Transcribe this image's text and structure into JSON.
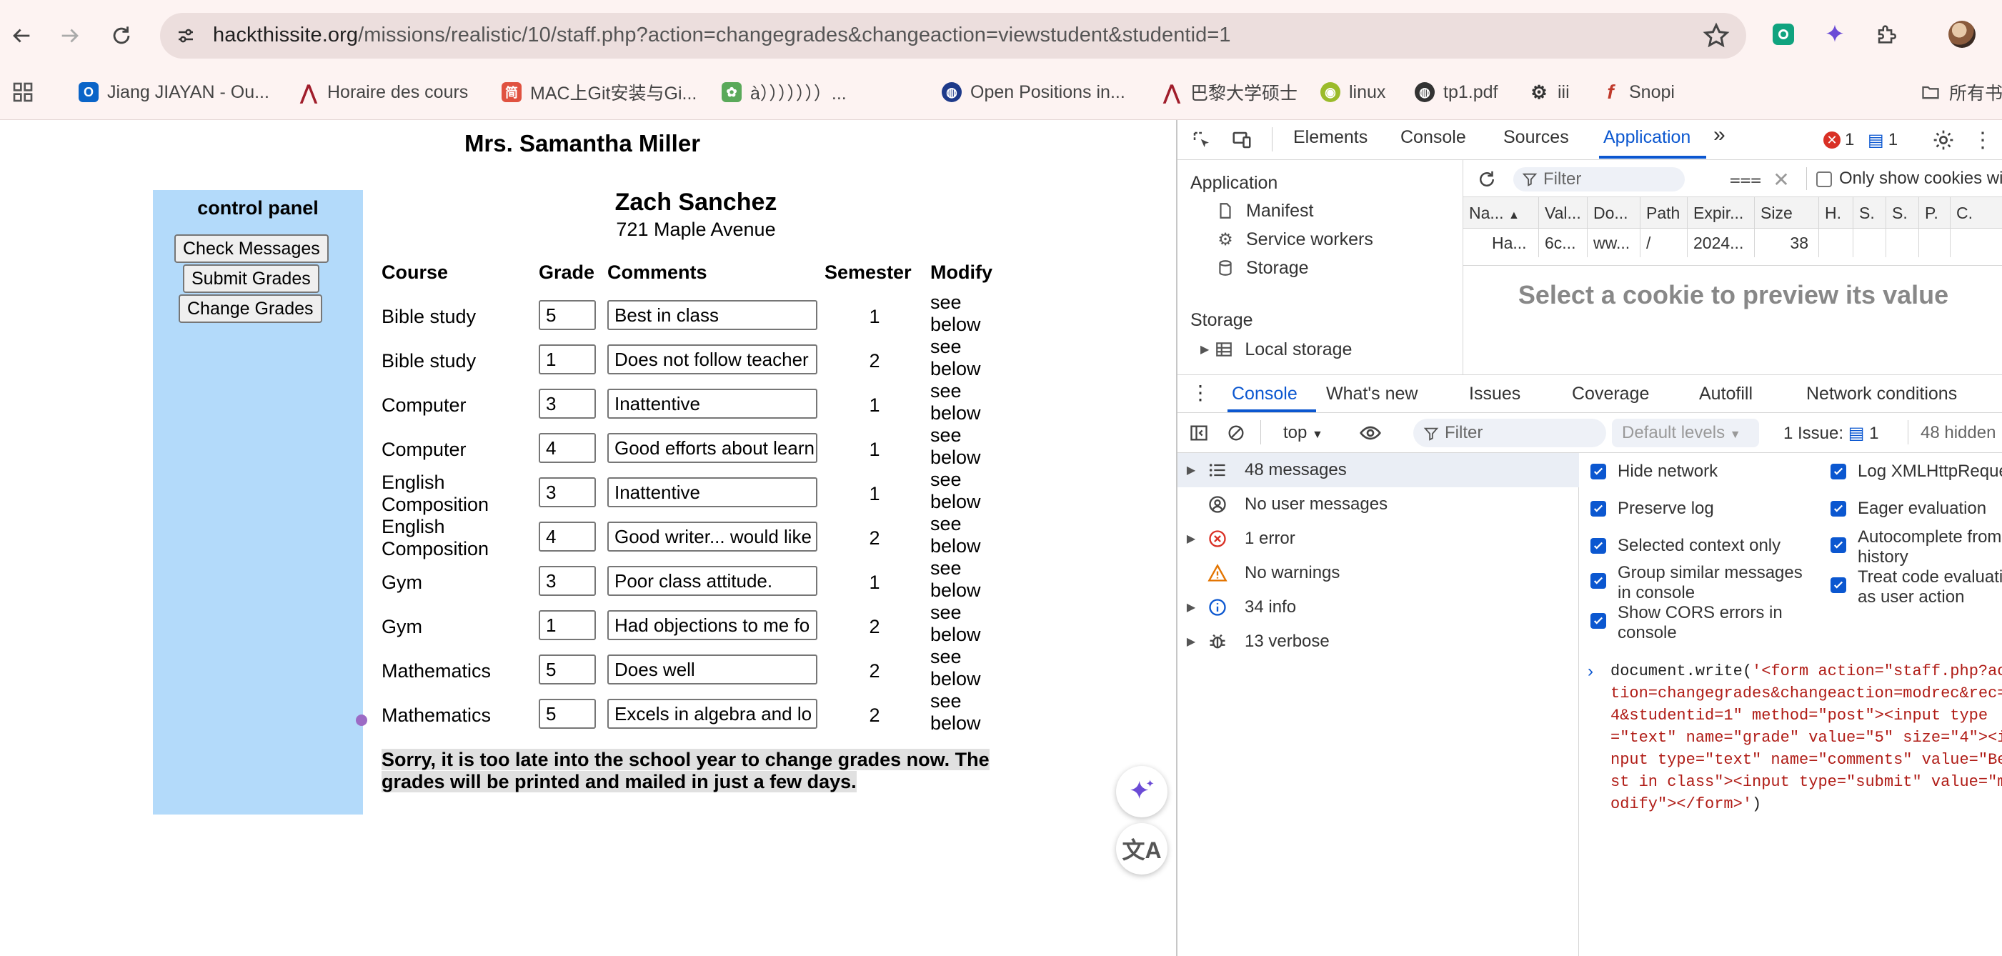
{
  "browser": {
    "url_host": "hackthissite.org",
    "url_path": "/missions/realistic/10/staff.php?action=changegrades&changeaction=viewstudent&studentid=1",
    "bookmarks": [
      {
        "label": "Jiang JIAYAN - Ou...",
        "icon": "outlook-icon",
        "color": "#0a64c8"
      },
      {
        "label": "Horaire des cours",
        "icon": "university-icon",
        "color": "#a01d2b"
      },
      {
        "label": "MAC上Git安装与Gi...",
        "icon": "jianshu-icon",
        "color": "#e05240"
      },
      {
        "label": "à）））））））...",
        "icon": "paw-icon",
        "color": "#5aa95a"
      },
      {
        "label": "Open Positions in...",
        "icon": "globe-icon",
        "color": "#1e3a8a"
      },
      {
        "label": "巴黎大学硕士",
        "icon": "university-icon",
        "color": "#a01d2b"
      },
      {
        "label": "linux",
        "icon": "linux-icon",
        "color": "#9bbb2b"
      },
      {
        "label": "tp1.pdf",
        "icon": "globe-icon",
        "color": "#333333"
      },
      {
        "label": "iii",
        "icon": "openai-icon",
        "color": "#333333"
      },
      {
        "label": "Snopi",
        "icon": "snopi-icon",
        "color": "#c0392b"
      },
      {
        "label": "所有书",
        "icon": "folder-icon",
        "color": "#555555"
      }
    ]
  },
  "page": {
    "teacher_name": "Mrs. Samantha Miller",
    "control_panel": {
      "title": "control panel",
      "buttons": [
        "Check Messages",
        "Submit Grades",
        "Change Grades"
      ]
    },
    "student": {
      "name": "Zach Sanchez",
      "address": "721 Maple Avenue"
    },
    "headers": {
      "course": "Course",
      "grade": "Grade",
      "comments": "Comments",
      "semester": "Semester",
      "modify": "Modify"
    },
    "rows": [
      {
        "course": "Bible study",
        "grade": "5",
        "comment": "Best in class",
        "semester": "1",
        "modify": "see below"
      },
      {
        "course": "Bible study",
        "grade": "1",
        "comment": "Does not follow teacher",
        "semester": "2",
        "modify": "see below"
      },
      {
        "course": "Computer",
        "grade": "3",
        "comment": "Inattentive",
        "semester": "1",
        "modify": "see below"
      },
      {
        "course": "Computer",
        "grade": "4",
        "comment": "Good efforts about learn",
        "semester": "1",
        "modify": "see below"
      },
      {
        "course": "English Composition",
        "grade": "3",
        "comment": "Inattentive",
        "semester": "1",
        "modify": "see below"
      },
      {
        "course": "English Composition",
        "grade": "4",
        "comment": "Good writer... would like",
        "semester": "2",
        "modify": "see below"
      },
      {
        "course": "Gym",
        "grade": "3",
        "comment": "Poor class attitude.",
        "semester": "1",
        "modify": "see below"
      },
      {
        "course": "Gym",
        "grade": "1",
        "comment": "Had objections to me fo",
        "semester": "2",
        "modify": "see below"
      },
      {
        "course": "Mathematics",
        "grade": "5",
        "comment": "Does well",
        "semester": "2",
        "modify": "see below"
      },
      {
        "course": "Mathematics",
        "grade": "5",
        "comment": "Excels in algebra and lo",
        "semester": "2",
        "modify": "see below"
      }
    ],
    "notice": "Sorry, it is too late into the school year to change grades now. The grades will be printed and mailed in just a few days."
  },
  "devtools": {
    "tabs": [
      "Elements",
      "Console",
      "Sources",
      "Application"
    ],
    "active_tab": "Application",
    "error_count": "1",
    "issue_count": "1",
    "app_sidebar": {
      "section_application": "Application",
      "items": [
        "Manifest",
        "Service workers",
        "Storage"
      ],
      "section_storage": "Storage",
      "storage_items": [
        "Local storage"
      ]
    },
    "cookies": {
      "filter_placeholder": "Filter",
      "only_show_issues": "Only show cookies with",
      "columns": [
        "Na...",
        "Val...",
        "Do...",
        "Path",
        "Expir...",
        "Size",
        "H.",
        "S.",
        "S.",
        "P.",
        "C."
      ],
      "row": [
        "Ha...",
        "6c...",
        "ww...",
        "/",
        "2024...",
        "38",
        "",
        "",
        "",
        "",
        ""
      ],
      "preview_text": "Select a cookie to preview its value"
    },
    "drawer_tabs": [
      "Console",
      "What's new",
      "Issues",
      "Coverage",
      "Autofill",
      "Network conditions"
    ],
    "console_toolbar": {
      "context": "top",
      "filter_placeholder": "Filter",
      "levels": "Default levels",
      "issues_label": "1 Issue:",
      "issues_count": "1",
      "hidden": "48 hidden"
    },
    "message_groups": [
      {
        "label": "48 messages",
        "icon": "list-icon",
        "expandable": true
      },
      {
        "label": "No user messages",
        "icon": "user-icon",
        "expandable": false
      },
      {
        "label": "1 error",
        "icon": "error-icon",
        "expandable": true
      },
      {
        "label": "No warnings",
        "icon": "warning-icon",
        "expandable": false
      },
      {
        "label": "34 info",
        "icon": "info-icon",
        "expandable": true
      },
      {
        "label": "13 verbose",
        "icon": "bug-icon",
        "expandable": true
      }
    ],
    "settings_left": [
      "Hide network",
      "Preserve log",
      "Selected context only",
      "Group similar messages in console",
      "Show CORS errors in console"
    ],
    "settings_right": [
      "Log XMLHttpReque",
      "Eager evaluation",
      "Autocomplete from history",
      "Treat code evaluati as user action"
    ],
    "console_code_prefix": "document.write(",
    "console_code_string": "'<form action=\"staff.php?action=changegrades&changeaction=modrec&rec=4&studentid=1\" method=\"post\"><input type=\"text\" name=\"grade\" value=\"5\" size=\"4\"><input type=\"text\" name=\"comments\" value=\"Best in class\"><input type=\"submit\" value=\"modify\"></form>'",
    "console_code_suffix": ")"
  }
}
